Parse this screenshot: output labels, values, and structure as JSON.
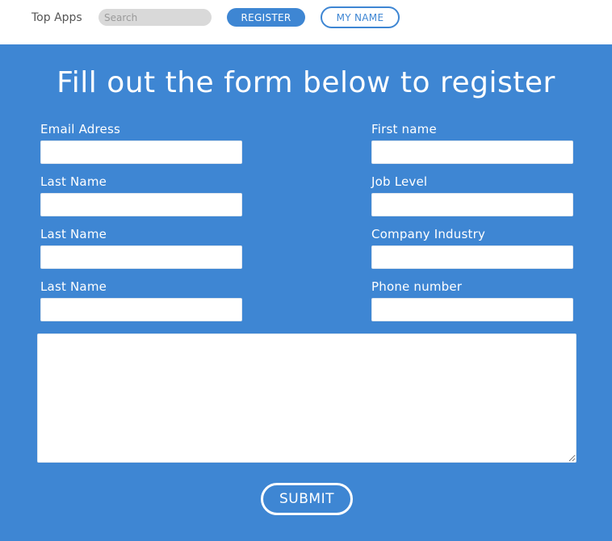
{
  "header": {
    "brand": "Top Apps",
    "search_placeholder": "Search",
    "register_label": "REGISTER",
    "myname_label": "MY NAME"
  },
  "form": {
    "title": "Fill out the form below to register",
    "left_fields": [
      {
        "label": "Email Adress",
        "value": ""
      },
      {
        "label": "Last Name",
        "value": ""
      },
      {
        "label": "Last Name",
        "value": ""
      },
      {
        "label": "Last Name",
        "value": ""
      }
    ],
    "right_fields": [
      {
        "label": "First name",
        "value": ""
      },
      {
        "label": "Job Level",
        "value": ""
      },
      {
        "label": "Company Industry",
        "value": ""
      },
      {
        "label": "Phone number",
        "value": ""
      }
    ],
    "message_value": "",
    "submit_label": "SUBMIT"
  },
  "colors": {
    "accent": "#3e86d3",
    "background": "#ffffff",
    "text_on_accent": "#ffffff"
  }
}
